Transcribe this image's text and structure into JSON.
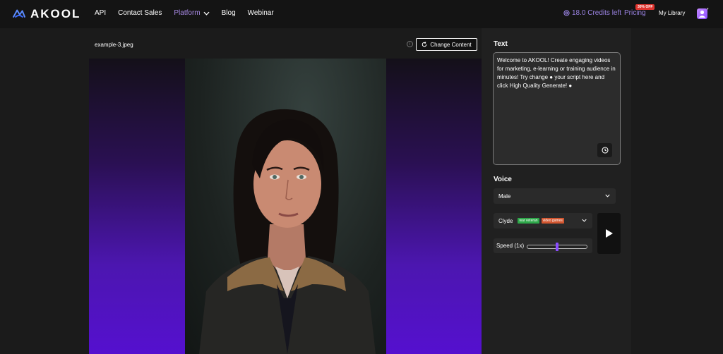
{
  "header": {
    "logo_text": "AKOOL",
    "nav": [
      {
        "label": "API"
      },
      {
        "label": "Contact Sales"
      },
      {
        "label": "Platform"
      },
      {
        "label": "Blog"
      },
      {
        "label": "Webinar"
      }
    ],
    "credits": "18.0 Credits left",
    "pricing": "Pricing",
    "pricing_badge": "30% OFF",
    "library": "My Library"
  },
  "editor": {
    "filename": "example-3.jpeg",
    "change_button": "Change Content",
    "info_icon": "i"
  },
  "panel": {
    "text_label": "Text",
    "script": "Welcome to AKOOL! Create engaging videos for marketing, e-learning or training audience in minutes! Try change ● your script here and click High Quality Generate! ●",
    "voice_label": "Voice",
    "voice_gender": "Male",
    "voice_name": "Clyde",
    "voice_tags": [
      "war veteran",
      "video games"
    ],
    "speed_label": "Speed (1x)",
    "speed_value": 0.5
  },
  "colors": {
    "accent": "#9a83e2",
    "slider_thumb": "#8b4dff",
    "badge": "#e0342e"
  }
}
